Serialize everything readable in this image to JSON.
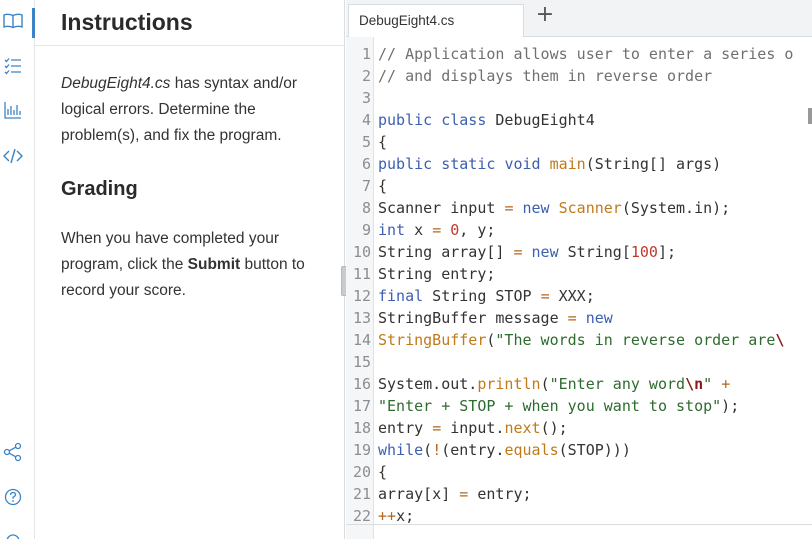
{
  "rail": {
    "icons": [
      "book-icon",
      "checklist-icon",
      "bar-chart-icon",
      "code-icon",
      "share-icon",
      "help-icon"
    ]
  },
  "instructions": {
    "title": "Instructions",
    "file_name": "DebugEight4.cs",
    "body_rest": " has syntax and/or logical errors. Determine the problem(s), and fix the program.",
    "grading_title": "Grading",
    "grading_prefix": "When you have completed your program, click the ",
    "grading_bold": "Submit",
    "grading_suffix": " button to record your score."
  },
  "editor": {
    "tab_label": "DebugEight4.cs",
    "add_tab_label": "+",
    "lines": [
      [
        {
          "t": "// Application allows user to enter a series o",
          "c": "cm"
        }
      ],
      [
        {
          "t": "// and displays them in reverse order",
          "c": "cm"
        }
      ],
      [],
      [
        {
          "t": "public",
          "c": "kw"
        },
        {
          "t": " ",
          "c": "pl"
        },
        {
          "t": "class",
          "c": "kw"
        },
        {
          "t": " DebugEight4",
          "c": "pl"
        }
      ],
      [
        {
          "t": "{",
          "c": "pl"
        }
      ],
      [
        {
          "t": "public",
          "c": "kw"
        },
        {
          "t": " ",
          "c": "pl"
        },
        {
          "t": "static",
          "c": "kw"
        },
        {
          "t": " ",
          "c": "pl"
        },
        {
          "t": "void",
          "c": "kw"
        },
        {
          "t": " ",
          "c": "pl"
        },
        {
          "t": "main",
          "c": "fn"
        },
        {
          "t": "(String[] args)",
          "c": "pl"
        }
      ],
      [
        {
          "t": "{",
          "c": "pl"
        }
      ],
      [
        {
          "t": "Scanner input ",
          "c": "pl"
        },
        {
          "t": "=",
          "c": "op"
        },
        {
          "t": " ",
          "c": "pl"
        },
        {
          "t": "new",
          "c": "kw"
        },
        {
          "t": " ",
          "c": "pl"
        },
        {
          "t": "Scanner",
          "c": "fn"
        },
        {
          "t": "(System.in);",
          "c": "pl"
        }
      ],
      [
        {
          "t": "int",
          "c": "kw"
        },
        {
          "t": " x ",
          "c": "pl"
        },
        {
          "t": "=",
          "c": "op"
        },
        {
          "t": " ",
          "c": "pl"
        },
        {
          "t": "0",
          "c": "num"
        },
        {
          "t": ", y;",
          "c": "pl"
        }
      ],
      [
        {
          "t": "String array[] ",
          "c": "pl"
        },
        {
          "t": "=",
          "c": "op"
        },
        {
          "t": " ",
          "c": "pl"
        },
        {
          "t": "new",
          "c": "kw"
        },
        {
          "t": " String[",
          "c": "pl"
        },
        {
          "t": "100",
          "c": "num"
        },
        {
          "t": "];",
          "c": "pl"
        }
      ],
      [
        {
          "t": "String entry;",
          "c": "pl"
        }
      ],
      [
        {
          "t": "final",
          "c": "kw"
        },
        {
          "t": " String STOP ",
          "c": "pl"
        },
        {
          "t": "=",
          "c": "op"
        },
        {
          "t": " XXX;",
          "c": "pl"
        }
      ],
      [
        {
          "t": "StringBuffer message ",
          "c": "pl"
        },
        {
          "t": "=",
          "c": "op"
        },
        {
          "t": " ",
          "c": "pl"
        },
        {
          "t": "new",
          "c": "kw"
        }
      ],
      [
        {
          "t": "StringBuffer",
          "c": "fn"
        },
        {
          "t": "(",
          "c": "pl"
        },
        {
          "t": "\"The words in reverse order are",
          "c": "str"
        },
        {
          "t": "\\",
          "c": "esc"
        }
      ],
      [],
      [
        {
          "t": "System.out.",
          "c": "pl"
        },
        {
          "t": "println",
          "c": "fn"
        },
        {
          "t": "(",
          "c": "pl"
        },
        {
          "t": "\"Enter any word",
          "c": "str"
        },
        {
          "t": "\\n",
          "c": "esc"
        },
        {
          "t": "\"",
          "c": "str"
        },
        {
          "t": " ",
          "c": "pl"
        },
        {
          "t": "+",
          "c": "op"
        }
      ],
      [
        {
          "t": "\"Enter + STOP + when you want to stop\"",
          "c": "str"
        },
        {
          "t": ");",
          "c": "pl"
        }
      ],
      [
        {
          "t": "entry ",
          "c": "pl"
        },
        {
          "t": "=",
          "c": "op"
        },
        {
          "t": " input.",
          "c": "pl"
        },
        {
          "t": "next",
          "c": "fn"
        },
        {
          "t": "();",
          "c": "pl"
        }
      ],
      [
        {
          "t": "while",
          "c": "kw"
        },
        {
          "t": "(",
          "c": "pl"
        },
        {
          "t": "!",
          "c": "op"
        },
        {
          "t": "(entry.",
          "c": "pl"
        },
        {
          "t": "equals",
          "c": "fn"
        },
        {
          "t": "(STOP)))",
          "c": "pl"
        }
      ],
      [
        {
          "t": "{",
          "c": "pl"
        }
      ],
      [
        {
          "t": "array[x] ",
          "c": "pl"
        },
        {
          "t": "=",
          "c": "op"
        },
        {
          "t": " entry;",
          "c": "pl"
        }
      ],
      [
        {
          "t": "++",
          "c": "op"
        },
        {
          "t": "x;",
          "c": "pl"
        }
      ]
    ]
  }
}
